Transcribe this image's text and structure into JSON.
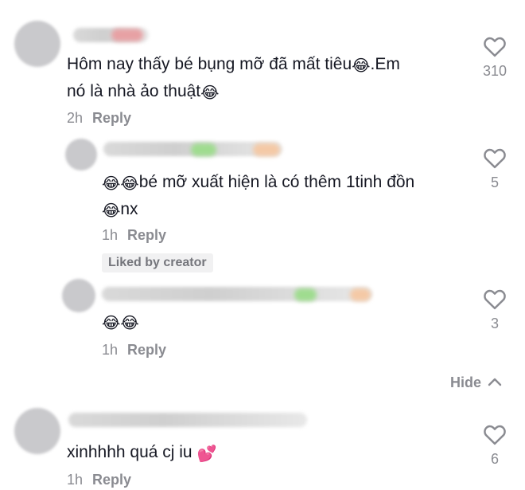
{
  "comments": [
    {
      "text_line1": "Hôm nay thấy bé bụng mỡ đã mất tiêu",
      "text_line1_tail": ".Em",
      "text_line2": "nó là nhà ảo thuật",
      "time": "2h",
      "reply_label": "Reply",
      "likes": "310"
    },
    {
      "text_line1": "bé mỡ xuất hiện là có thêm 1tinh đồn",
      "text_line2": "nx",
      "time": "1h",
      "reply_label": "Reply",
      "badge": "Liked by creator",
      "likes": "5"
    },
    {
      "time": "1h",
      "reply_label": "Reply",
      "likes": "3"
    },
    {
      "text_line1": "xinhhhh quá cj iu",
      "time": "1h",
      "reply_label": "Reply",
      "likes": "6"
    }
  ],
  "hide_label": "Hide",
  "icons": {
    "laughing": "😂",
    "hearts": "💕"
  },
  "colors": {
    "text": "#161823",
    "meta": "#8a8b91",
    "heart_outline": "#8a8b91",
    "hearts_emoji": "#ff4fa3"
  }
}
